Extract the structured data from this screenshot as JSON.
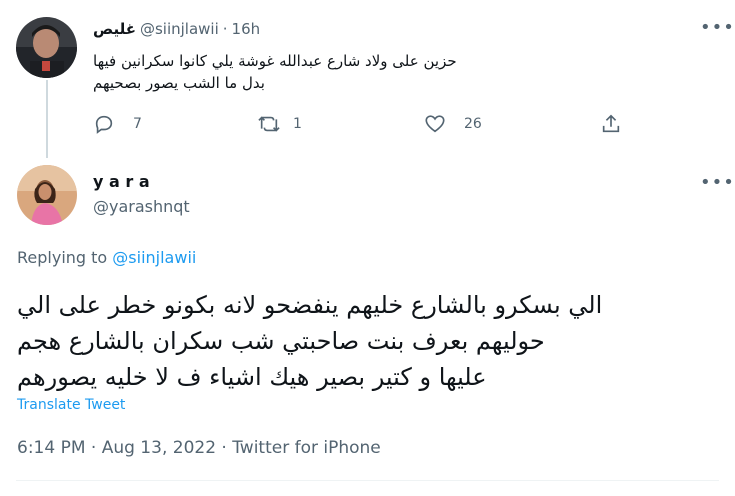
{
  "parent_tweet": {
    "display_name": "غليص",
    "handle": "@siinjlawii",
    "separator": "·",
    "time": "16h",
    "more": "•••",
    "text_line1": "حزين على ولاد شارع عبدالله غوشة يلي كانوا سكرانين فيها",
    "text_line2": "بدل ما الشب يصور بصحيهم",
    "reply_count": "7",
    "retweet_count": "1",
    "like_count": "26"
  },
  "main_tweet": {
    "display_name": "y a r a",
    "handle": "@yarashnqt",
    "more": "•••",
    "replying_label": "Replying to",
    "replying_handle": "@siinjlawii",
    "text_line1": "الي بسكرو بالشارع خليهم ينفضحو لانه بكونو خطر على الي",
    "text_line2": "حوليهم بعرف بنت صاحبتي شب سكران بالشارع هجم",
    "text_line3": "عليها و كتير بصير هيك اشياء ف لا خليه يصورهم",
    "translate": "Translate Tweet",
    "timestamp": "6:14 PM · Aug 13, 2022 · Twitter for iPhone"
  },
  "icons": [
    "reply-icon",
    "retweet-icon",
    "like-icon",
    "share-icon",
    "more-icon"
  ],
  "colors": {
    "accent": "#1d9bf0",
    "secondary_text": "#536471",
    "thread_line": "#cfd9de"
  }
}
